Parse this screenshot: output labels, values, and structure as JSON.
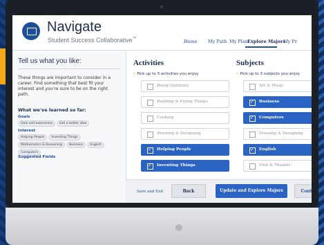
{
  "header": {
    "brand": "Navigate",
    "tagline": "Student Success Collaborative",
    "tagline_tm": "™",
    "nav": [
      "Home",
      "My Path",
      "My Plan",
      "Explore Majors",
      "My Pr"
    ]
  },
  "left": {
    "title": "Tell us what you like:",
    "intro": "These things are important to consider in a career. Find something that best fit your interest and you're sure to be on the right path.",
    "learned_heading": "What we've learned so far:",
    "goals_label": "Goals",
    "goals": [
      "Gain self-awareness",
      "Get a better idea"
    ],
    "interest_label": "Interest",
    "interest": [
      "Helping People",
      "Inventing Things",
      "Mathematics & Reasoning",
      "Business",
      "English",
      "Computers"
    ],
    "suggested_label": "Suggested Fields"
  },
  "activities": {
    "title": "Activities",
    "prompt": "Pick up to 3 activities you enjoy",
    "options": [
      {
        "label": "Being Outdoors",
        "selected": false
      },
      {
        "label": "Building & Fixing Things",
        "selected": false
      },
      {
        "label": "Cooking",
        "selected": false
      },
      {
        "label": "Drawing & Designing",
        "selected": false
      },
      {
        "label": "Helping People",
        "selected": true
      },
      {
        "label": "Inventing Things",
        "selected": true
      }
    ]
  },
  "subjects": {
    "title": "Subjects",
    "prompt": "Pick up to 3 subjects you enjoy",
    "options": [
      {
        "label": "Art & Music",
        "selected": false
      },
      {
        "label": "Business",
        "selected": true
      },
      {
        "label": "Computers",
        "selected": true
      },
      {
        "label": "Drawing & Designing",
        "selected": false
      },
      {
        "label": "English",
        "selected": true
      },
      {
        "label": "Film & Theater",
        "selected": false
      }
    ]
  },
  "footer": {
    "save_label": "Save and Exit",
    "back_label": "Back",
    "update_label": "Update and Explore Majors",
    "continue_label": "Continue"
  },
  "colors": {
    "accent": "#2a63c4",
    "brand": "#1b2d4f",
    "highlight": "#f1a81d"
  },
  "icons": [
    "shield-logo-icon",
    "checkbox-icon",
    "bullet-icon"
  ]
}
